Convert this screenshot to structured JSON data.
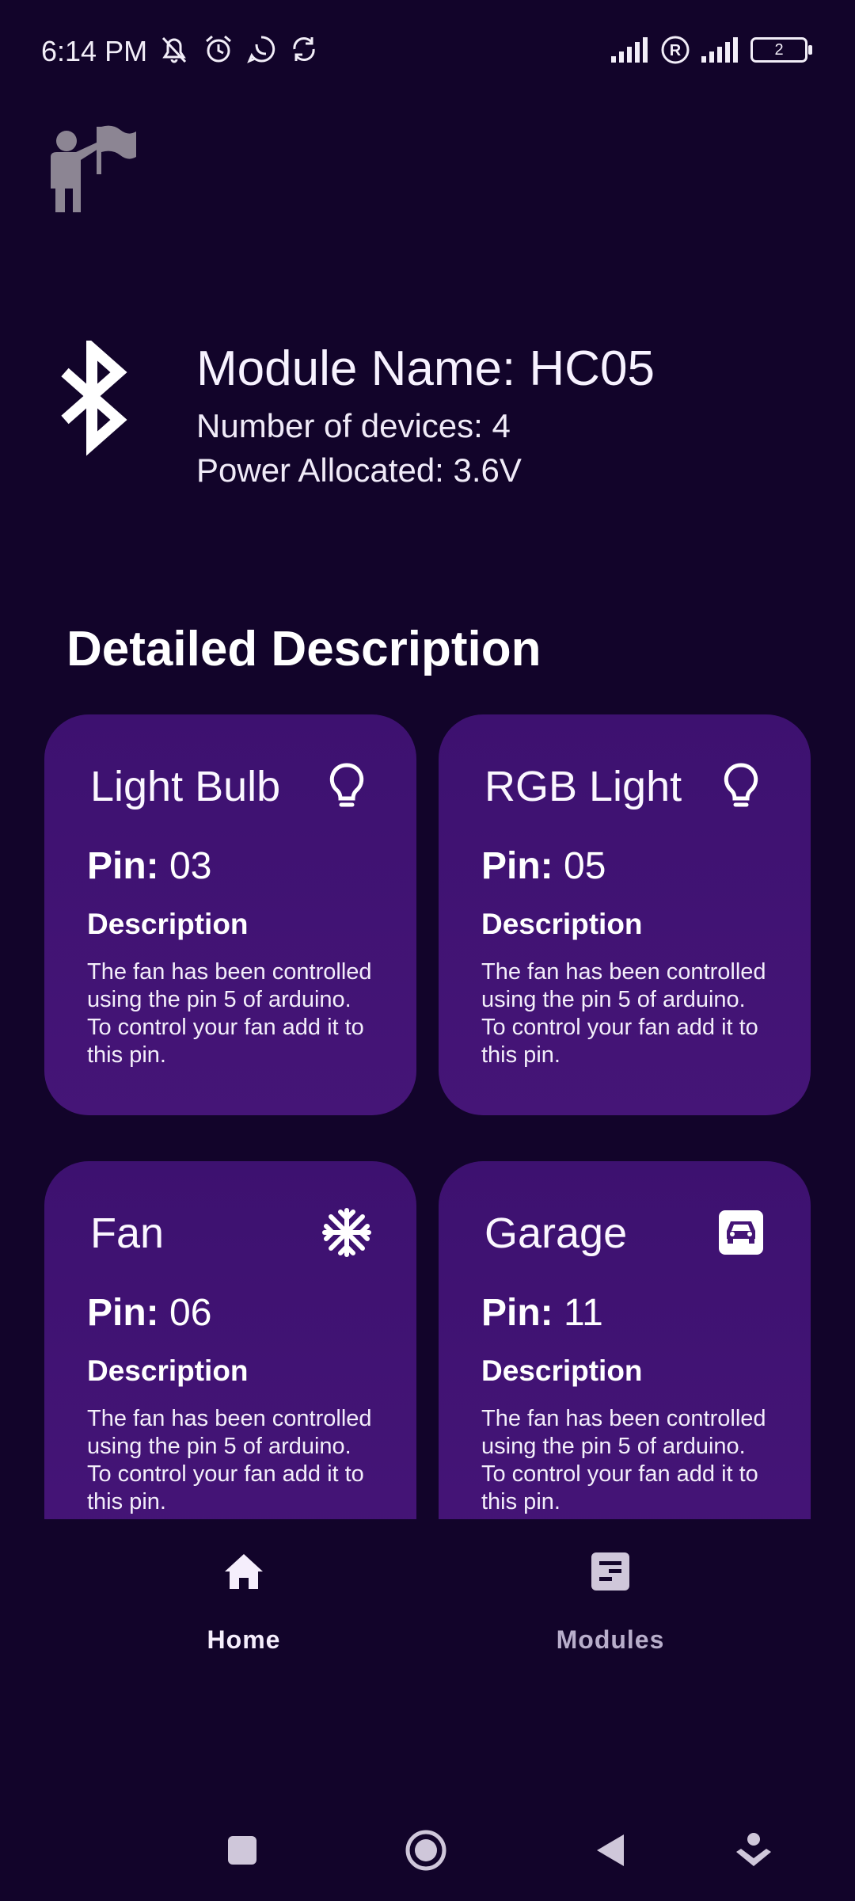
{
  "status_bar": {
    "time": "6:14 PM",
    "icons": [
      "muted-bell-icon",
      "alarm-icon",
      "whatsapp-icon",
      "sync-icon"
    ],
    "right_icons": [
      "signal-icon",
      "roaming-icon",
      "signal-icon"
    ],
    "battery": "2"
  },
  "module": {
    "name": "Module Name: HC05",
    "devices": "Number of devices: 4",
    "power": "Power Allocated: 3.6V"
  },
  "section_title": "Detailed Description",
  "cards": [
    {
      "title": "Light Bulb",
      "icon": "lightbulb-icon",
      "pin_label": "Pin:",
      "pin": "03",
      "desc_heading": "Description",
      "desc": "The fan has been controlled using the pin 5 of arduino. To control your fan add it to this pin."
    },
    {
      "title": "RGB Light",
      "icon": "lightbulb-icon",
      "pin_label": "Pin:",
      "pin": "05",
      "desc_heading": "Description",
      "desc": "The fan has been controlled using the pin 5 of arduino. To control your fan add it to this pin."
    },
    {
      "title": "Fan",
      "icon": "snowflake-icon",
      "pin_label": "Pin:",
      "pin": "06",
      "desc_heading": "Description",
      "desc": "The fan has been controlled using the pin 5 of arduino. To control your fan add it to this pin."
    },
    {
      "title": "Garage",
      "icon": "car-icon",
      "pin_label": "Pin:",
      "pin": "11",
      "desc_heading": "Description",
      "desc": "The fan has been controlled using the pin 5 of arduino. To control your fan add it to this pin."
    }
  ],
  "nav": {
    "items": [
      {
        "label": "Home",
        "icon": "home-icon",
        "active": true
      },
      {
        "label": "Modules",
        "icon": "document-icon",
        "active": false
      }
    ]
  },
  "colors": {
    "background": "#12042a",
    "card": "#3f1272",
    "nav_active": "#f5eefc",
    "nav_inactive": "#b8aecb"
  }
}
